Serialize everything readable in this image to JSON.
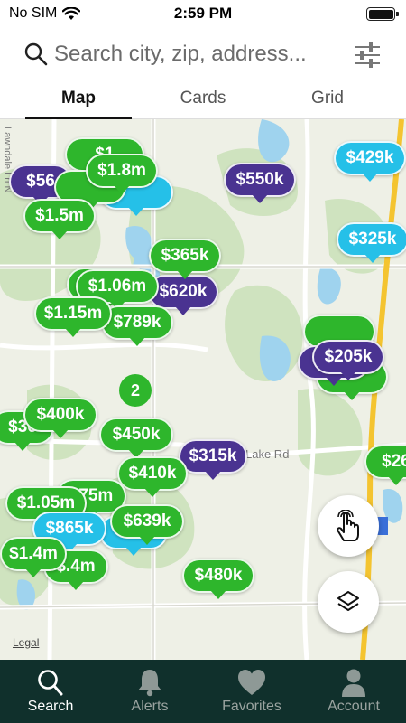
{
  "status_bar": {
    "carrier": "No SIM",
    "time": "2:59 PM"
  },
  "search": {
    "placeholder": "Search city, zip, address..."
  },
  "tabs": [
    {
      "label": "Map",
      "active": true
    },
    {
      "label": "Cards",
      "active": false
    },
    {
      "label": "Grid",
      "active": false
    }
  ],
  "map": {
    "road_labels": [
      "Lake Rd",
      "Lawndale Ln N"
    ],
    "legal_label": "Legal",
    "cluster_count": "2",
    "pins": [
      {
        "price": "$56",
        "color": "purple"
      },
      {
        "price": "$1",
        "color": "green"
      },
      {
        "price": "$1.8m",
        "color": "green"
      },
      {
        "price": "$1.5m",
        "color": "green"
      },
      {
        "price": "$550k",
        "color": "purple"
      },
      {
        "price": "$429k",
        "color": "cyan"
      },
      {
        "price": "$325k",
        "color": "cyan"
      },
      {
        "price": "$365k",
        "color": "green"
      },
      {
        "price": "$1.06m",
        "color": "green"
      },
      {
        "price": "$620k",
        "color": "purple"
      },
      {
        "price": "$1.15m",
        "color": "green"
      },
      {
        "price": "$789k",
        "color": "green"
      },
      {
        "price": "$205k",
        "color": "purple"
      },
      {
        "price": "$400k",
        "color": "green"
      },
      {
        "price": "$36",
        "color": "green"
      },
      {
        "price": "$450k",
        "color": "green"
      },
      {
        "price": "$315k",
        "color": "purple"
      },
      {
        "price": "$26",
        "color": "green"
      },
      {
        "price": "$410k",
        "color": "green"
      },
      {
        "price": "$1.05m",
        "color": "green"
      },
      {
        "price": "$75m",
        "color": "green"
      },
      {
        "price": "$865k",
        "color": "cyan"
      },
      {
        "price": "$639k",
        "color": "green"
      },
      {
        "price": "$1.4m",
        "color": "green"
      },
      {
        "price": "$.4m",
        "color": "green"
      },
      {
        "price": "$480k",
        "color": "green"
      }
    ]
  },
  "bottom_nav": [
    {
      "label": "Search",
      "icon": "search-icon",
      "active": true
    },
    {
      "label": "Alerts",
      "icon": "bell-icon",
      "active": false
    },
    {
      "label": "Favorites",
      "icon": "heart-icon",
      "active": false
    },
    {
      "label": "Account",
      "icon": "person-icon",
      "active": false
    }
  ],
  "colors": {
    "pin_green": "#2eb62c",
    "pin_purple": "#4a3391",
    "pin_cyan": "#25c0e8",
    "nav_background": "#10302c"
  }
}
